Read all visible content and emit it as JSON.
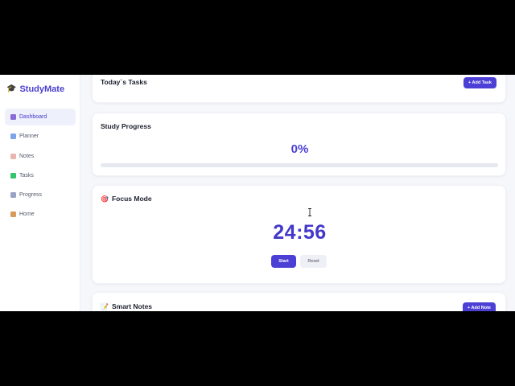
{
  "colors": {
    "accent": "#4b3fd6",
    "brand": "#4a3fd0",
    "background": "#f6f7fb",
    "track": "#e6e8ef"
  },
  "brand": {
    "name": "StudyMate",
    "icon": "graduation-cap-icon"
  },
  "sidebar": {
    "items": [
      {
        "label": "Dashboard",
        "icon": "chart-icon",
        "active": true
      },
      {
        "label": "Planner",
        "icon": "calendar-icon",
        "active": false
      },
      {
        "label": "Notes",
        "icon": "memo-icon",
        "active": false
      },
      {
        "label": "Tasks",
        "icon": "checkbox-icon",
        "active": false
      },
      {
        "label": "Progress",
        "icon": "trend-icon",
        "active": false
      },
      {
        "label": "Home",
        "icon": "house-icon",
        "active": false
      }
    ]
  },
  "tasks": {
    "title": "Today`s Tasks",
    "add_label": "+ Add Task"
  },
  "progress": {
    "title": "Study Progress",
    "value_text": "0%",
    "fraction": 0
  },
  "focus": {
    "title": "Focus Mode",
    "icon": "target-icon",
    "timer": "24:56",
    "start_label": "Start",
    "reset_label": "Reset"
  },
  "notes": {
    "title": "Smart Notes",
    "icon": "memo-icon",
    "add_label": "+ Add Note"
  }
}
